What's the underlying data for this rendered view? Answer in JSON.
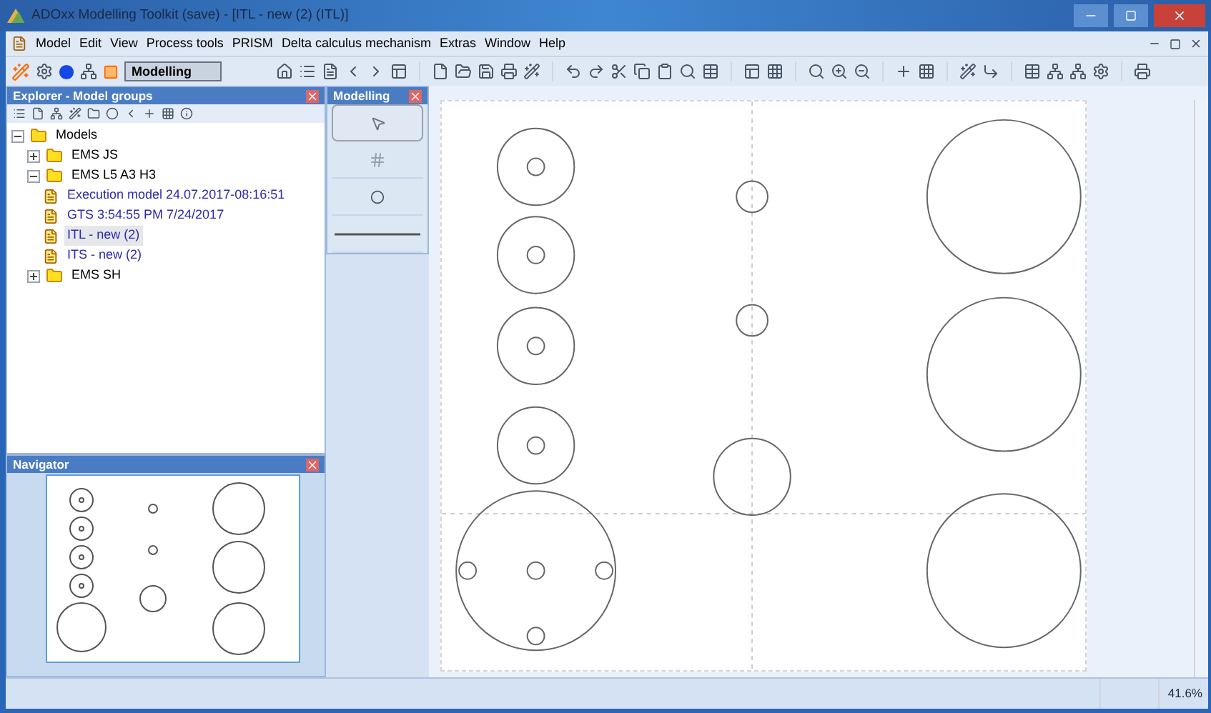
{
  "window": {
    "title": "ADOxx Modelling Toolkit (save) - [ITL - new (2) (ITL)]"
  },
  "menu": [
    "Model",
    "Edit",
    "View",
    "Process tools",
    "PRISM",
    "Delta calculus mechanism",
    "Extras",
    "Window",
    "Help"
  ],
  "toolbar": {
    "mode": "Modelling"
  },
  "explorer": {
    "title": "Explorer - Model groups",
    "tree": [
      {
        "label": "Models",
        "kind": "group",
        "expanded": true,
        "children": [
          {
            "label": "EMS JS",
            "kind": "group",
            "expanded": false
          },
          {
            "label": "EMS L5 A3 H3",
            "kind": "group",
            "expanded": true,
            "children": [
              {
                "label": "Execution model 24.07.2017-08:16:51",
                "kind": "model",
                "selected": false
              },
              {
                "label": "GTS 3:54:55 PM 7/24/2017",
                "kind": "model",
                "selected": false
              },
              {
                "label": "ITL - new (2)",
                "kind": "model",
                "selected": true
              },
              {
                "label": "ITS - new (2)",
                "kind": "model",
                "selected": false
              }
            ]
          },
          {
            "label": "EMS SH",
            "kind": "group",
            "expanded": false
          }
        ]
      }
    ]
  },
  "modelling_palette": {
    "title": "Modelling",
    "tools": [
      {
        "kind": "pointer",
        "selected": true
      },
      {
        "kind": "grid",
        "selected": false
      },
      {
        "kind": "circle",
        "selected": false
      },
      {
        "kind": "line",
        "selected": false
      }
    ]
  },
  "navigator": {
    "title": "Navigator"
  },
  "status_bar": {
    "zoom": "41.6%"
  }
}
